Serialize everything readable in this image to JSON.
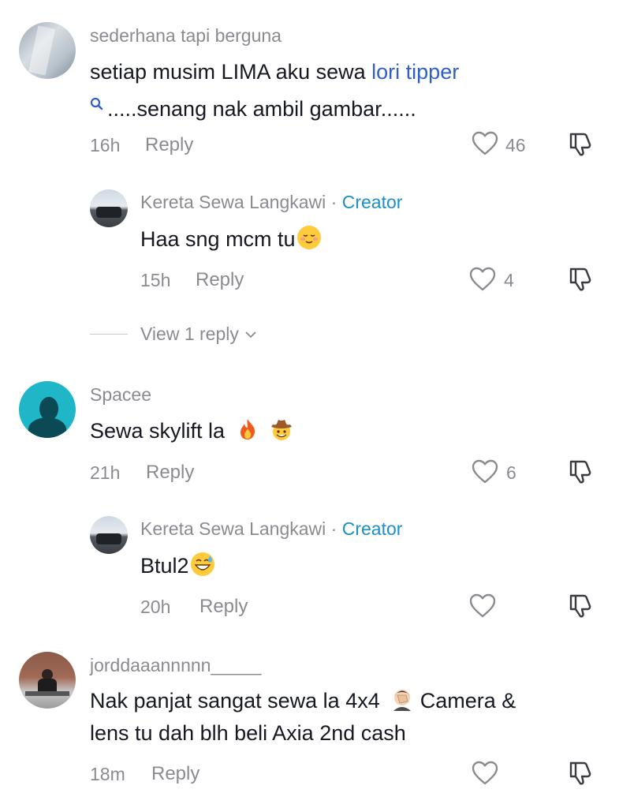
{
  "comments": [
    {
      "username": "sederhana tapi berguna",
      "text_line1_prefix": "setiap musim LIMA aku sewa ",
      "link_text": "lori tipper",
      "text_line2": ".....senang nak ambil gambar......",
      "time": "16h",
      "reply_label": "Reply",
      "likes": "46",
      "replies": [
        {
          "username": "Kereta Sewa Langkawi",
          "separator": " · ",
          "badge": "Creator",
          "text": "Haa sng mcm tu",
          "time": "15h",
          "reply_label": "Reply",
          "likes": "4"
        }
      ],
      "view_replies": "View 1 reply"
    },
    {
      "username": "Spacee",
      "text": "Sewa skylift la",
      "time": "21h",
      "reply_label": "Reply",
      "likes": "6",
      "replies": [
        {
          "username": "Kereta Sewa Langkawi",
          "separator": " · ",
          "badge": "Creator",
          "text": "Btul2",
          "time": "20h",
          "reply_label": "Reply",
          "likes": ""
        }
      ]
    },
    {
      "username": "jorddaaannnnn_____",
      "text_line1": "Nak panjat sangat sewa la 4x4",
      "text_line1_suffix": " Camera &",
      "text_line2": "lens tu dah blh beli Axia 2nd cash",
      "time": "18m",
      "reply_label": "Reply",
      "likes": ""
    }
  ],
  "icons": {
    "heart": "heart-outline-icon",
    "dislike": "thumbs-down-icon",
    "search": "search-icon",
    "chevron": "chevron-down-icon"
  },
  "colors": {
    "creator": "#1a8fc9",
    "link": "#2f5fc9",
    "meta": "#8a8b91"
  }
}
